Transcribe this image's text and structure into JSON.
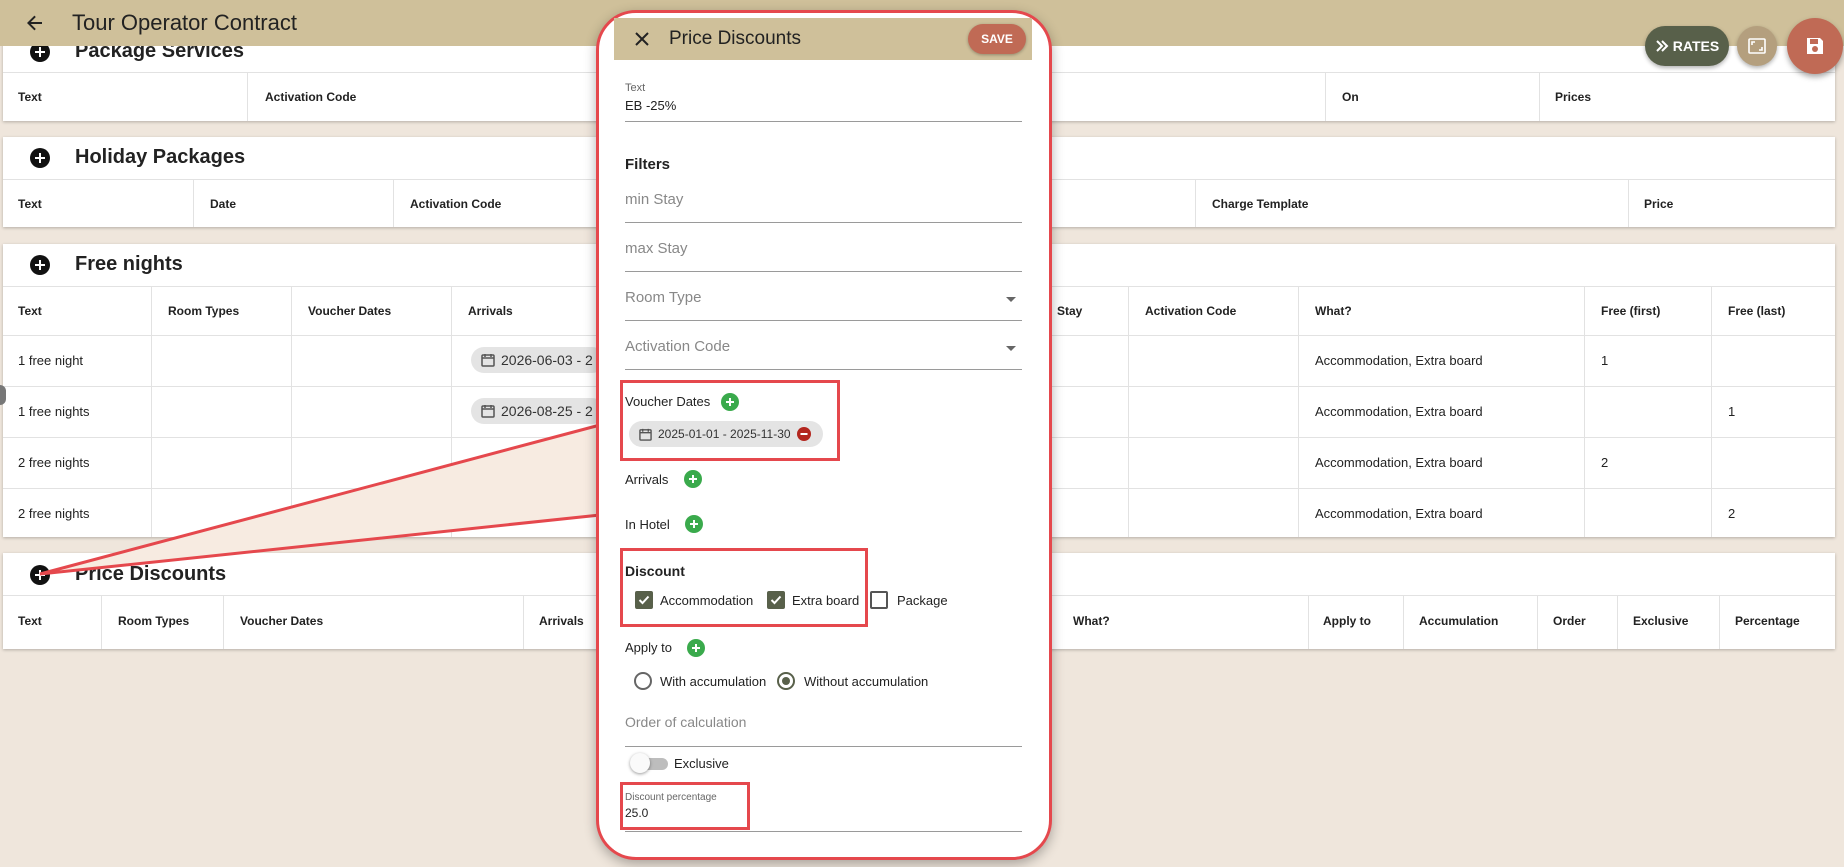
{
  "app": {
    "title": "Tour Operator Contract",
    "rates_label": "RATES"
  },
  "package_services": {
    "title": "Package Services",
    "headers": [
      "Text",
      "Activation Code",
      "On",
      "Prices"
    ]
  },
  "holiday_packages": {
    "title": "Holiday Packages",
    "headers": [
      "Text",
      "Date",
      "Activation Code",
      "Charge Template",
      "Price"
    ]
  },
  "free_nights": {
    "title": "Free nights",
    "headers": [
      "Text",
      "Room Types",
      "Voucher Dates",
      "Arrivals",
      "Stay",
      "Activation Code",
      "What?",
      "Free (first)",
      "Free (last)"
    ],
    "rows": [
      {
        "text": "1 free night",
        "arrival_chip": "2026-06-03 - 2",
        "what": "Accommodation, Extra board",
        "free_first": "1",
        "free_last": ""
      },
      {
        "text": "1 free nights",
        "arrival_chip": "2026-08-25 - 2",
        "what": "Accommodation, Extra board",
        "free_first": "",
        "free_last": "1"
      },
      {
        "text": "2 free nights",
        "arrival_chip": "",
        "what": "Accommodation, Extra board",
        "free_first": "2",
        "free_last": ""
      },
      {
        "text": "2 free nights",
        "arrival_chip": "",
        "what": "Accommodation, Extra board",
        "free_first": "",
        "free_last": "2"
      }
    ]
  },
  "price_discounts": {
    "title": "Price Discounts",
    "headers": [
      "Text",
      "Room Types",
      "Voucher Dates",
      "Arrivals",
      "What?",
      "Apply to",
      "Accumulation",
      "Order",
      "Exclusive",
      "Percentage"
    ]
  },
  "dialog": {
    "title": "Price Discounts",
    "save_label": "SAVE",
    "text_label": "Text",
    "text_value": "EB -25%",
    "filters_title": "Filters",
    "min_stay_placeholder": "min Stay",
    "max_stay_placeholder": "max Stay",
    "room_type_placeholder": "Room Type",
    "activation_code_placeholder": "Activation Code",
    "voucher_dates_label": "Voucher Dates",
    "voucher_chip": "2025-01-01 - 2025-11-30",
    "arrivals_label": "Arrivals",
    "in_hotel_label": "In Hotel",
    "discount_title": "Discount",
    "discount_options": [
      {
        "label": "Accommodation",
        "checked": true
      },
      {
        "label": "Extra board",
        "checked": true
      },
      {
        "label": "Package",
        "checked": false
      }
    ],
    "apply_to_label": "Apply to",
    "accumulation_options": [
      {
        "label": "With accumulation",
        "selected": false
      },
      {
        "label": "Without accumulation",
        "selected": true
      }
    ],
    "order_placeholder": "Order of calculation",
    "exclusive_label": "Exclusive",
    "exclusive_on": false,
    "discount_percentage_label": "Discount percentage",
    "discount_percentage_value": "25.0"
  },
  "colors": {
    "appbar": "#cfc09a",
    "background": "#efe6dc",
    "accent_dark": "#58604a",
    "save_red": "#c06a55",
    "highlight_red": "#e5484d",
    "add_green": "#3aaa4c"
  }
}
